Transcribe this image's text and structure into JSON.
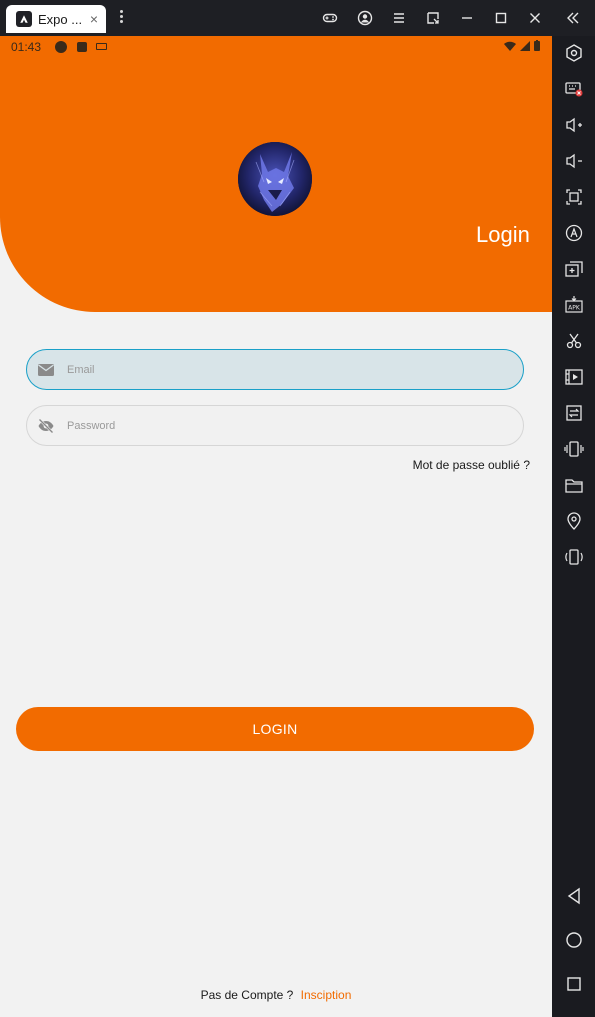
{
  "window": {
    "tab_title": "Expo ...",
    "tab_close": "×"
  },
  "status": {
    "time": "01:43"
  },
  "header": {
    "title": "Login"
  },
  "form": {
    "email_placeholder": "Email",
    "password_placeholder": "Password",
    "forgot_label": "Mot de passe oublié ?",
    "login_button": "LOGIN"
  },
  "footer": {
    "no_account": "Pas de Compte ?",
    "signup_link": "Insciption"
  },
  "colors": {
    "accent": "#f26b00",
    "focus_border": "#1aa0c8",
    "background": "#f2f2f2"
  },
  "icons": {
    "toolbar": [
      "gamepad-icon",
      "account-icon",
      "menu-icon",
      "resize-icon",
      "minimize-icon",
      "maximize-icon",
      "close-icon",
      "collapse-icon"
    ],
    "sidebar": [
      "settings-hex-icon",
      "keyboard-off-icon",
      "volume-up-icon",
      "volume-down-icon",
      "screenshot-icon",
      "auto-rotate-icon",
      "multi-instance-icon",
      "apk-install-icon",
      "scissors-icon",
      "video-icon",
      "sync-icon",
      "shake-icon",
      "folder-icon",
      "location-icon",
      "rotate-icon",
      "back-icon",
      "home-icon",
      "recents-icon"
    ]
  }
}
